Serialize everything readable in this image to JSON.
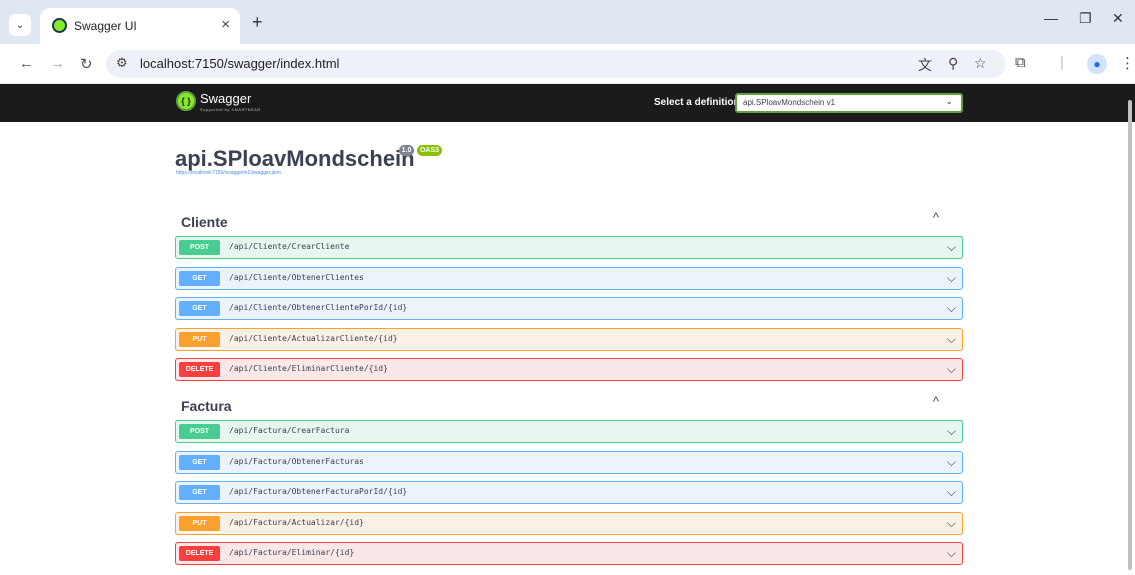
{
  "browser": {
    "tab_title": "Swagger UI",
    "url": "localhost:7150/swagger/index.html"
  },
  "swagger": {
    "logo_text": "Swagger",
    "logo_sub": "Supported by SMARTBEAR",
    "select_label": "Select a definition",
    "select_value": "api.SPloavMondschein v1"
  },
  "info": {
    "title": "api.SPloavMondschein",
    "version": "1.0",
    "oas": "OAS3",
    "link": "https://localhost:7150/swagger/v1/swagger.json"
  },
  "sections": [
    {
      "name": "Cliente",
      "operations": [
        {
          "method": "POST",
          "path": "/api/Cliente/CrearCliente"
        },
        {
          "method": "GET",
          "path": "/api/Cliente/ObtenerClientes"
        },
        {
          "method": "GET",
          "path": "/api/Cliente/ObtenerClientePorId/{id}"
        },
        {
          "method": "PUT",
          "path": "/api/Cliente/ActualizarCliente/{id}"
        },
        {
          "method": "DELETE",
          "path": "/api/Cliente/EliminarCliente/{id}"
        }
      ]
    },
    {
      "name": "Factura",
      "operations": [
        {
          "method": "POST",
          "path": "/api/Factura/CrearFactura"
        },
        {
          "method": "GET",
          "path": "/api/Factura/ObtenerFacturas"
        },
        {
          "method": "GET",
          "path": "/api/Factura/ObtenerFacturaPorId/{id}"
        },
        {
          "method": "PUT",
          "path": "/api/Factura/Actualizar/{id}"
        },
        {
          "method": "DELETE",
          "path": "/api/Factura/Eliminar/{id}"
        }
      ]
    }
  ],
  "colors": {
    "post": "#49cc90",
    "get": "#61affe",
    "put": "#fca130",
    "delete": "#f93e3e",
    "topbar": "#1b1b1b",
    "accent": "#85ea2d"
  }
}
